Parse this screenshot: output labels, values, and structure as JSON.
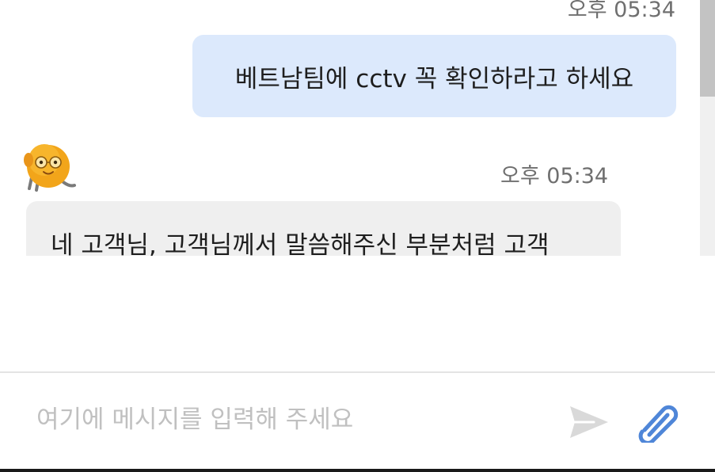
{
  "messages": {
    "user": {
      "time": "오후 05:34",
      "text": "베트남팀에 cctv 꼭 확인하라고 하세요"
    },
    "agent": {
      "time": "오후 05:34",
      "text": "네 고객님, 고객님께서 말씀해주신 부분처럼 고객"
    }
  },
  "composer": {
    "placeholder": "여기에 메시지를 입력해 주세요",
    "value": ""
  },
  "icons": {
    "avatar": "bot-character-avatar",
    "send": "send-icon",
    "attach": "paperclip-icon"
  },
  "colors": {
    "user_bubble": "#dce9fc",
    "agent_bubble": "#efefef",
    "timestamp": "#6f6f6f",
    "placeholder": "#c0c0c0",
    "send_icon": "#d9d9d9",
    "attach_icon": "#4f86d8",
    "avatar_body": "#f2a51a"
  }
}
